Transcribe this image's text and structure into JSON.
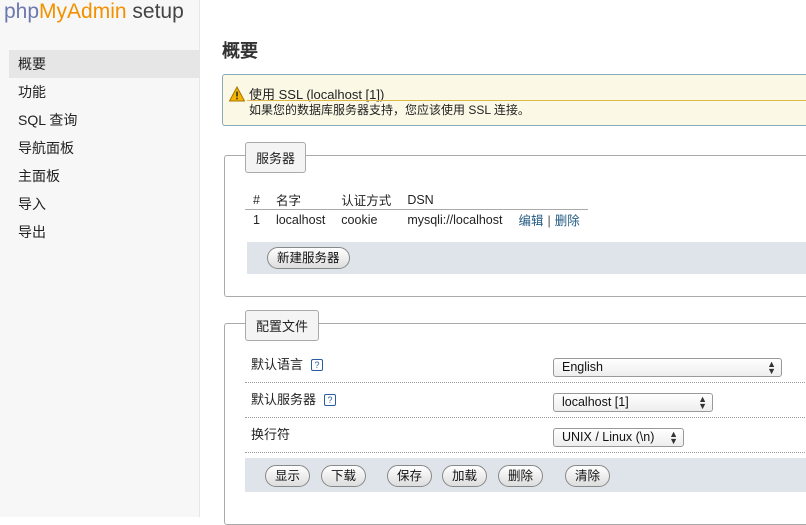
{
  "logo": {
    "part1": "php",
    "part2": "MyAdmin",
    "part3": " setup"
  },
  "nav": {
    "items": [
      "概要",
      "功能",
      "SQL 查询",
      "导航面板",
      "主面板",
      "导入",
      "导出"
    ]
  },
  "page_title": "概要",
  "notice": {
    "title": "使用 SSL (localhost [1])",
    "message": "如果您的数据库服务器支持，您应该使用 SSL 连接。"
  },
  "servers": {
    "legend": "服务器",
    "headers": [
      "#",
      "名字",
      "认证方式",
      "DSN"
    ],
    "row": {
      "num": "1",
      "name": "localhost",
      "auth": "cookie",
      "dsn": "mysqli://localhost",
      "edit": "编辑",
      "sep": "|",
      "delete": "删除"
    },
    "new_server": "新建服务器"
  },
  "config": {
    "legend": "配置文件",
    "rows": [
      {
        "label": "默认语言",
        "help": "?",
        "value": "English"
      },
      {
        "label": "默认服务器",
        "help": "?",
        "value": "localhost [1]"
      },
      {
        "label": "换行符",
        "value": "UNIX / Linux (\\n)"
      }
    ],
    "buttons": {
      "display": "显示",
      "download": "下载",
      "save": "保存",
      "load": "加载",
      "delete": "删除",
      "clear": "清除"
    }
  },
  "colors": {
    "logo_php": "#6c78af",
    "logo_myadmin": "#f29100",
    "link": "#235a81",
    "warning": "#f29100"
  }
}
